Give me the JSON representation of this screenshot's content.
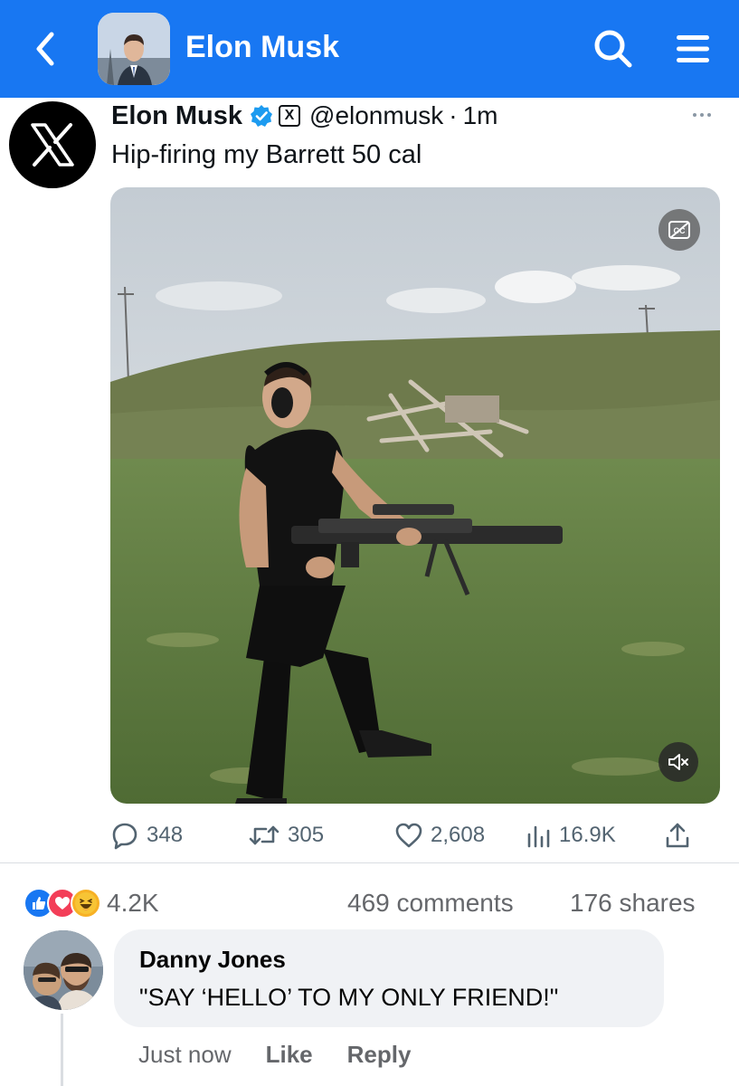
{
  "header": {
    "title": "Elon Musk",
    "back_icon": "chevron-left-icon",
    "search_icon": "search-icon",
    "menu_icon": "menu-icon",
    "accent_color": "#1877f2"
  },
  "tweet": {
    "author_name": "Elon Musk",
    "badge_x": "X",
    "handle": "@elonmusk",
    "separator": "·",
    "time": "1m",
    "text": "Hip-firing my Barrett 50 cal",
    "actions": {
      "replies": "348",
      "retweets": "305",
      "likes": "2,608",
      "views": "16.9K"
    }
  },
  "post_stats": {
    "reactions_count": "4.2K",
    "reaction_types": [
      "like",
      "love",
      "haha"
    ],
    "comments": "469 comments",
    "shares": "176 shares"
  },
  "comment": {
    "author": "Danny Jones",
    "text": "\"SAY ‘HELLO’ TO MY ONLY FRIEND!\"",
    "time": "Just now",
    "like_label": "Like",
    "reply_label": "Reply"
  }
}
